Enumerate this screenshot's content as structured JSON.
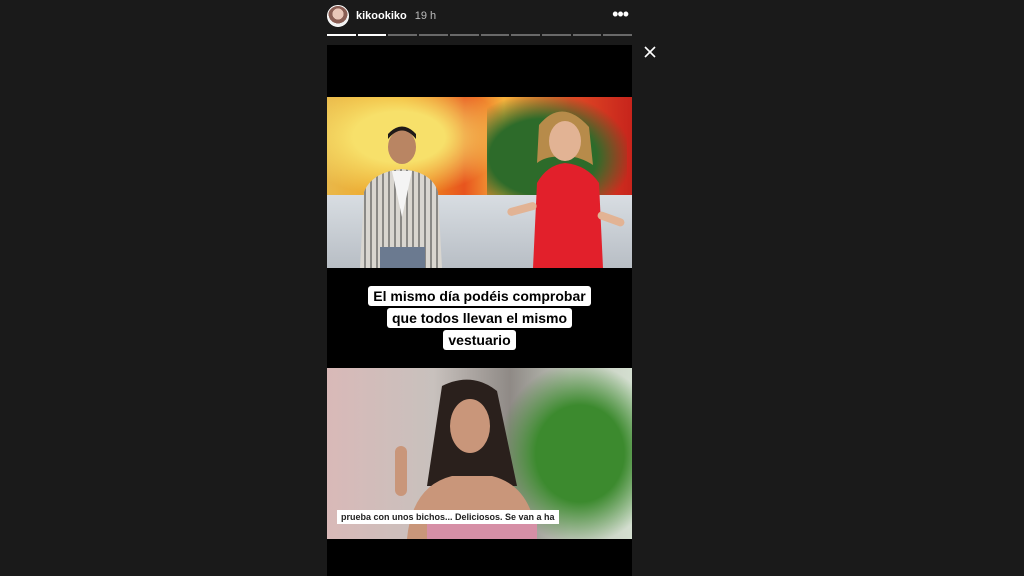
{
  "story": {
    "username": "kikookiko",
    "time": "19 h",
    "progress": {
      "total_segments": 10,
      "completed_segments": 2
    },
    "caption_lines": [
      "El mismo día podéis comprobar",
      "que todos llevan el mismo",
      "vestuario"
    ],
    "subtitle": "prueba con unos bichos... Deliciosos. Se van a ha"
  },
  "icons": {
    "more": "more-options-icon",
    "close": "close-icon"
  }
}
